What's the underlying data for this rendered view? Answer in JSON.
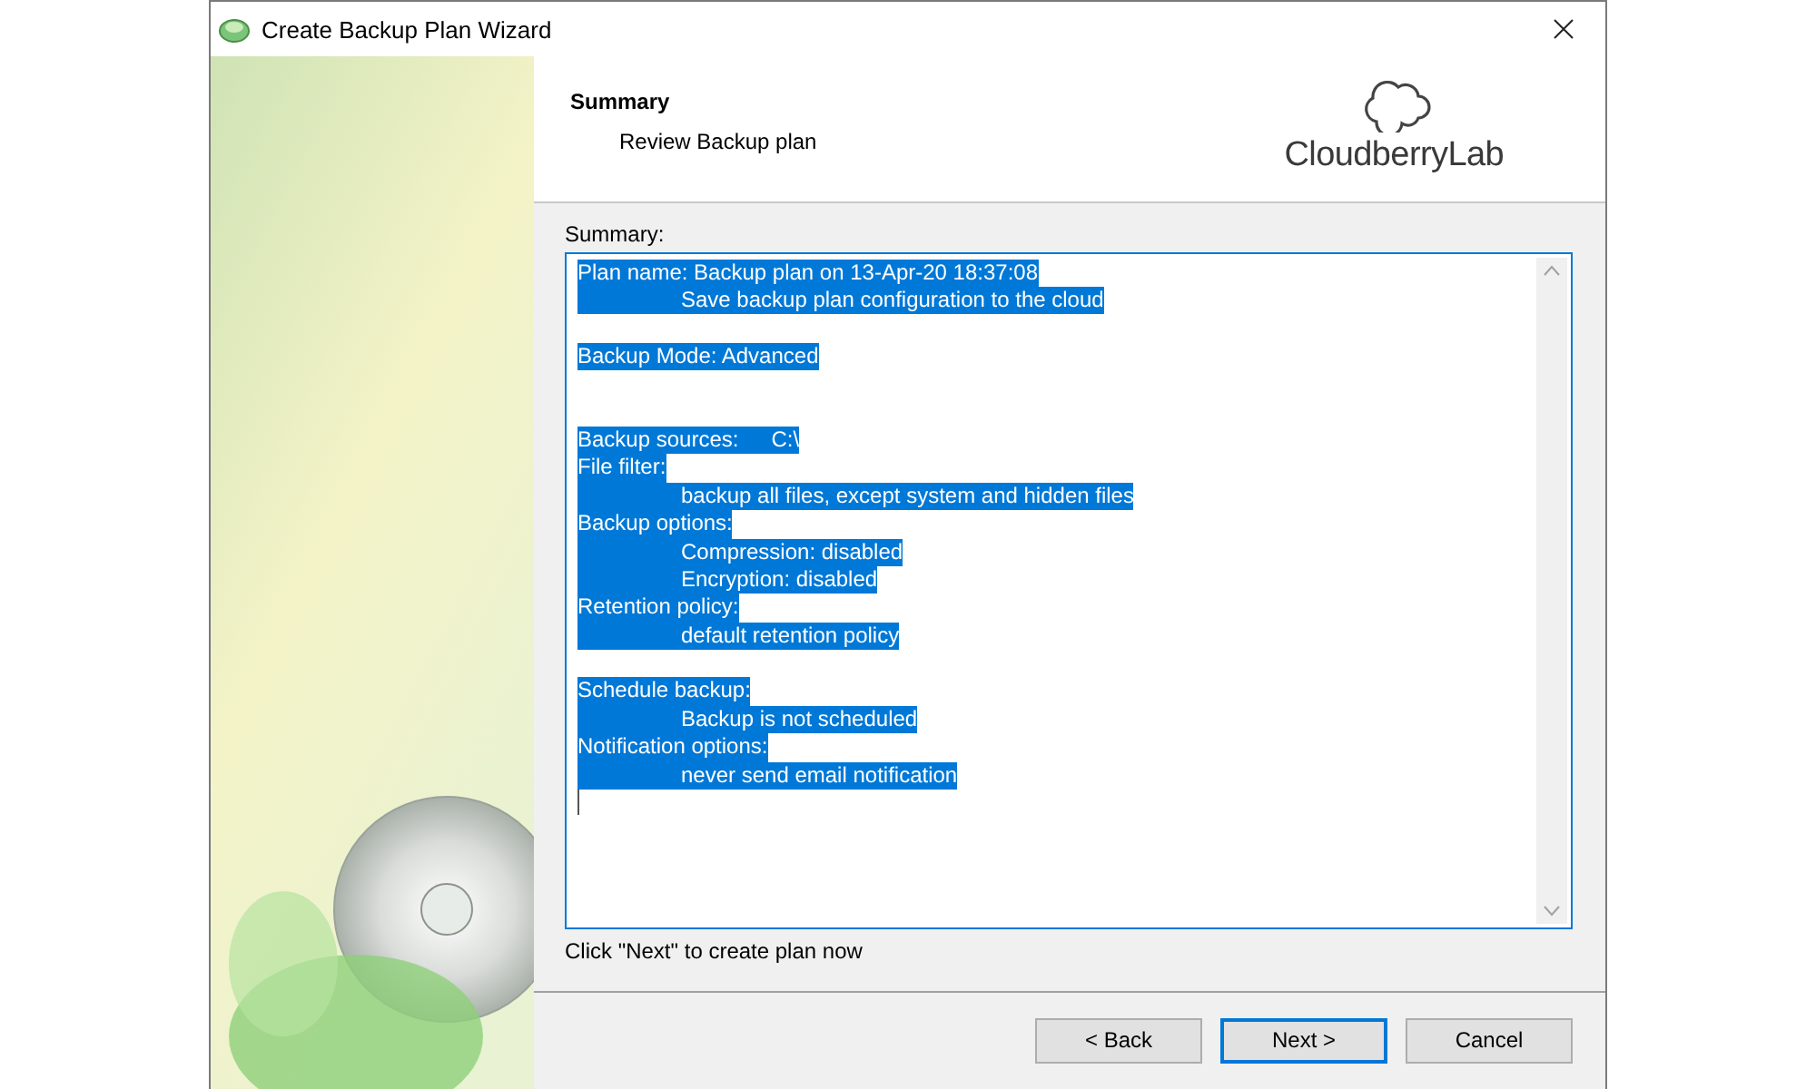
{
  "window": {
    "title": "Create Backup Plan Wizard"
  },
  "header": {
    "title": "Summary",
    "subtitle": "Review Backup plan",
    "logo_text": "CloudberryLab"
  },
  "summary": {
    "label": "Summary:",
    "lines": [
      {
        "kind": "top",
        "text": "Plan name: Backup plan on 13-Apr-20 18:37:08"
      },
      {
        "kind": "indented",
        "text": "Save backup plan configuration to the cloud"
      },
      {
        "kind": "blank"
      },
      {
        "kind": "top",
        "text": "Backup Mode: Advanced"
      },
      {
        "kind": "blank"
      },
      {
        "kind": "blank"
      },
      {
        "kind": "top",
        "text": "Backup sources:\tC:\\"
      },
      {
        "kind": "top",
        "text": "File filter:"
      },
      {
        "kind": "indented",
        "text": "backup all files, except system and hidden files"
      },
      {
        "kind": "top",
        "text": "Backup options:"
      },
      {
        "kind": "indented",
        "text": "Compression: disabled"
      },
      {
        "kind": "indented",
        "text": "Encryption: disabled"
      },
      {
        "kind": "top",
        "text": "Retention policy:"
      },
      {
        "kind": "indented",
        "text": "default retention policy"
      },
      {
        "kind": "blank"
      },
      {
        "kind": "top",
        "text": "Schedule backup:"
      },
      {
        "kind": "indented",
        "text": "Backup is not scheduled"
      },
      {
        "kind": "top",
        "text": "Notification options:"
      },
      {
        "kind": "indented",
        "text": "never send email notification"
      }
    ],
    "hint": "Click \"Next\" to create plan now"
  },
  "buttons": [
    {
      "label": "< Back",
      "selected": false
    },
    {
      "label": "Next >",
      "selected": true
    },
    {
      "label": "Cancel",
      "selected": false
    }
  ]
}
